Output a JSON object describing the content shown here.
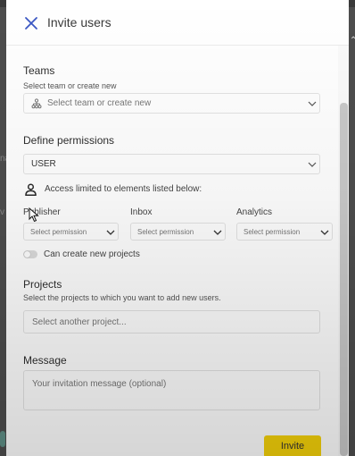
{
  "dialog": {
    "title": "Invite users"
  },
  "teams": {
    "title": "Teams",
    "hint": "Select team or create new",
    "placeholder": "Select team or create new",
    "icon": "team-hierarchy-icon"
  },
  "permissions": {
    "title": "Define permissions",
    "role_value": "USER",
    "access_note": "Access limited to elements listed below:",
    "access_icon": "person-icon",
    "columns": [
      {
        "label": "Publisher",
        "select": "Select permission"
      },
      {
        "label": "Inbox",
        "select": "Select permission"
      },
      {
        "label": "Analytics",
        "select": "Select permission"
      }
    ],
    "create_projects_label": "Can create new projects",
    "create_projects_enabled": false
  },
  "projects": {
    "title": "Projects",
    "hint": "Select the projects to which you want to add new users.",
    "placeholder": "Select another project..."
  },
  "message": {
    "title": "Message",
    "placeholder": "Your invitation message (optional)"
  },
  "actions": {
    "invite_label": "Invite"
  },
  "colors": {
    "accent_yellow": "#f5d20a",
    "close_icon": "#3b57c4"
  }
}
